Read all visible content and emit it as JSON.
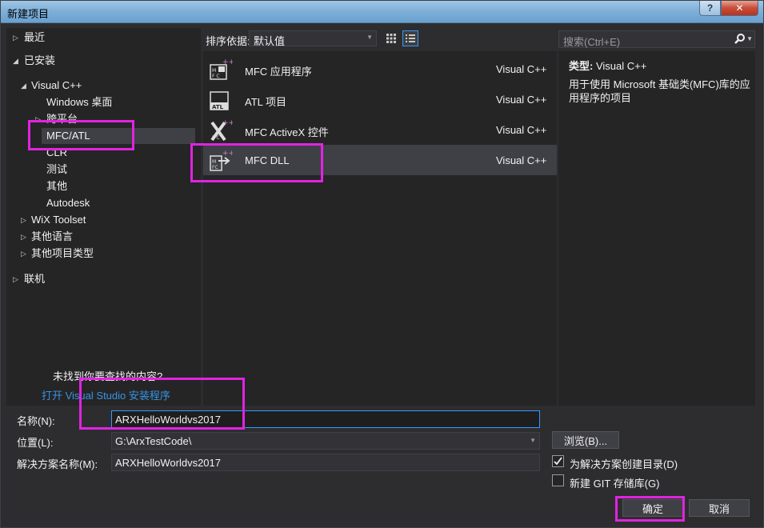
{
  "window": {
    "title": "新建项目",
    "help_btn": "?",
    "close_btn": "✕"
  },
  "tree": {
    "recent": "最近",
    "installed": "已安装",
    "visual_cpp": "Visual C++",
    "windows_desktop": "Windows 桌面",
    "cross_platform": "跨平台",
    "mfc_atl": "MFC/ATL",
    "clr": "CLR",
    "test": "测试",
    "other": "其他",
    "autodesk": "Autodesk",
    "wix": "WiX Toolset",
    "other_languages": "其他语言",
    "other_project_types": "其他项目类型",
    "online": "联机"
  },
  "left_footer": {
    "hint": "未找到你要查找的内容?",
    "link": "打开 Visual Studio 安装程序"
  },
  "sort": {
    "label": "排序依据:",
    "value": "默认值"
  },
  "templates": [
    {
      "name": "MFC 应用程序",
      "lang": "Visual C++",
      "icon": "mfc-app-icon"
    },
    {
      "name": "ATL 项目",
      "lang": "Visual C++",
      "icon": "atl-project-icon"
    },
    {
      "name": "MFC ActiveX 控件",
      "lang": "Visual C++",
      "icon": "mfc-activex-icon"
    },
    {
      "name": "MFC DLL",
      "lang": "Visual C++",
      "icon": "mfc-dll-icon"
    }
  ],
  "search": {
    "placeholder": "搜索(Ctrl+E)"
  },
  "details": {
    "type_label": "类型:",
    "type_value": "Visual C++",
    "description": "用于使用 Microsoft 基础类(MFC)库的应用程序的项目"
  },
  "form": {
    "name_label": "名称(N):",
    "name_value": "ARXHelloWorldvs2017",
    "location_label": "位置(L):",
    "location_value": "G:\\ArxTestCode\\",
    "solution_label": "解决方案名称(M):",
    "solution_value": "ARXHelloWorldvs2017",
    "browse": "浏览(B)...",
    "create_dir_label": "为解决方案创建目录(D)",
    "create_dir_checked": true,
    "git_label": "新建 GIT 存储库(G)",
    "git_checked": false,
    "ok": "确定",
    "cancel": "取消"
  },
  "colors": {
    "highlight": "#e024e0",
    "accent": "#3399ff",
    "link": "#3794e6"
  }
}
